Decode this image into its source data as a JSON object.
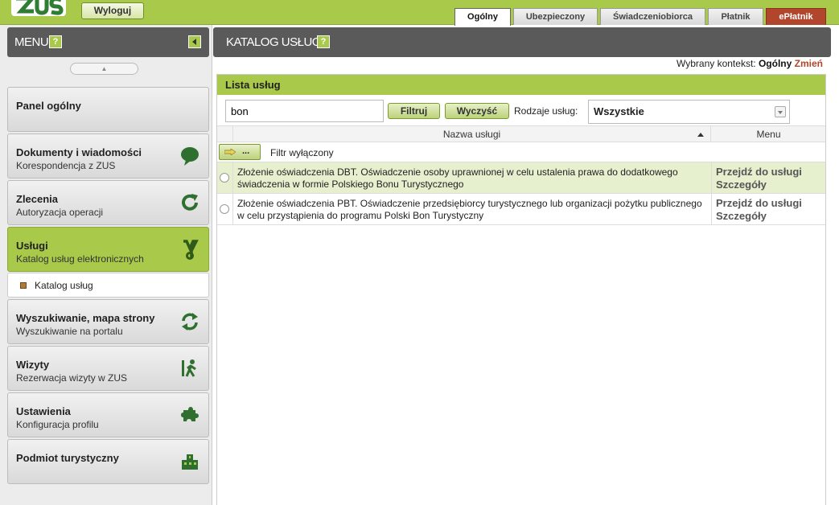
{
  "topbar": {
    "logout_label": "Wyloguj",
    "tabs": [
      {
        "label": "Ogólny",
        "active": true
      },
      {
        "label": "Ubezpieczony",
        "active": false
      },
      {
        "label": "Świadczeniobiorca",
        "active": false
      },
      {
        "label": "Płatnik",
        "active": false
      },
      {
        "label": "ePłatnik",
        "active": false
      }
    ]
  },
  "sidebar": {
    "title": "MENU",
    "help": "?",
    "scroll_up": "▲",
    "items": [
      {
        "title": "Panel ogólny",
        "subtitle": "",
        "icon": "none"
      },
      {
        "title": "Dokumenty i wiadomości",
        "subtitle": "Korespondencja z ZUS",
        "icon": "speech-bubble-icon"
      },
      {
        "title": "Zlecenia",
        "subtitle": "Autoryzacja operacji",
        "icon": "refresh-icon"
      },
      {
        "title": "Usługi",
        "subtitle": "Katalog usług elektronicznych",
        "icon": "services-icon"
      },
      {
        "title": "Wyszukiwanie, mapa strony",
        "subtitle": "Wyszukiwanie na portalu",
        "icon": "sync-icon"
      },
      {
        "title": "Wizyty",
        "subtitle": "Rezerwacja wizyty w ZUS",
        "icon": "walking-person-icon"
      },
      {
        "title": "Ustawienia",
        "subtitle": "Konfiguracja profilu",
        "icon": "puzzle-icon"
      },
      {
        "title": "Podmiot turystyczny",
        "subtitle": "",
        "icon": "buildings-icon"
      }
    ],
    "submenu": {
      "label": "Katalog usług"
    }
  },
  "main": {
    "title": "KATALOG USŁUG",
    "help": "?",
    "context": {
      "prefix": "Wybrany kontekst:",
      "value": "Ogólny",
      "change": "Zmień"
    },
    "panel": {
      "title": "Lista usług",
      "search_value": "bon",
      "filter_button": "Filtruj",
      "clear_button": "Wyczyść",
      "types_label": "Rodzaje usług:",
      "types_value": "Wszystkie",
      "columns": {
        "name": "Nazwa usługi",
        "menu": "Menu"
      },
      "filter_btn_label": "...",
      "filter_status": "Filtr wyłączony",
      "rows": [
        {
          "name": "Złożenie oświadczenia DBT. Oświadczenie osoby uprawnionej w celu ustalenia prawa do dodatkowego świadczenia w formie Polskiego Bonu Turystycznego",
          "link1": "Przejdź do usługi",
          "link2": "Szczegóły",
          "selected": true
        },
        {
          "name": "Złożenie oświadczenia PBT. Oświadczenie przedsiębiorcy turystycznego lub organizacji pożytku publicznego w celu przystąpienia do programu Polski Bon Turystyczny",
          "link1": "Przejdź do usługi",
          "link2": "Szczegóły",
          "selected": false
        }
      ]
    }
  },
  "colors": {
    "brand_green": "#a8c94a",
    "header_gray": "#5a5a5a",
    "accent_red": "#b2462c"
  }
}
